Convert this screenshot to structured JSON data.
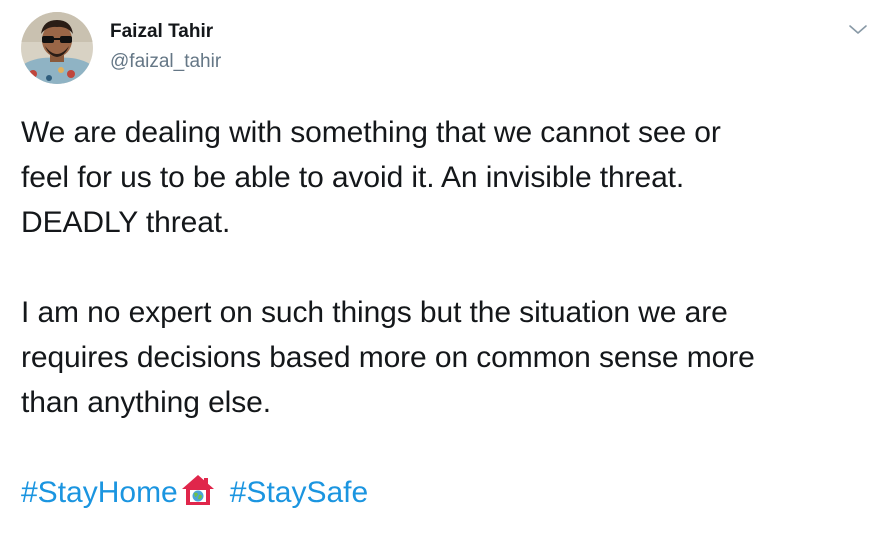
{
  "author": {
    "display_name": "Faizal Tahir",
    "handle": "@faizal_tahir",
    "avatar_icon": "profile-photo-avatar"
  },
  "menu": {
    "icon": "chevron-down-icon"
  },
  "tweet": {
    "paragraph1": [
      "We are dealing with something that we cannot see or",
      "feel for us to be able to avoid it. An invisible threat.",
      "DEADLY threat."
    ],
    "paragraph2": [
      "I am no expert on such things but the situation we are",
      "requires decisions based more on common sense more",
      "than anything else."
    ],
    "hashtags": [
      "#StayHome",
      "#StaySafe"
    ],
    "emoji": "house-with-globe-emoji"
  },
  "colors": {
    "text": "#14171a",
    "secondary_text": "#657786",
    "link": "#1b95e0",
    "emoji_house": "#e0264b"
  }
}
